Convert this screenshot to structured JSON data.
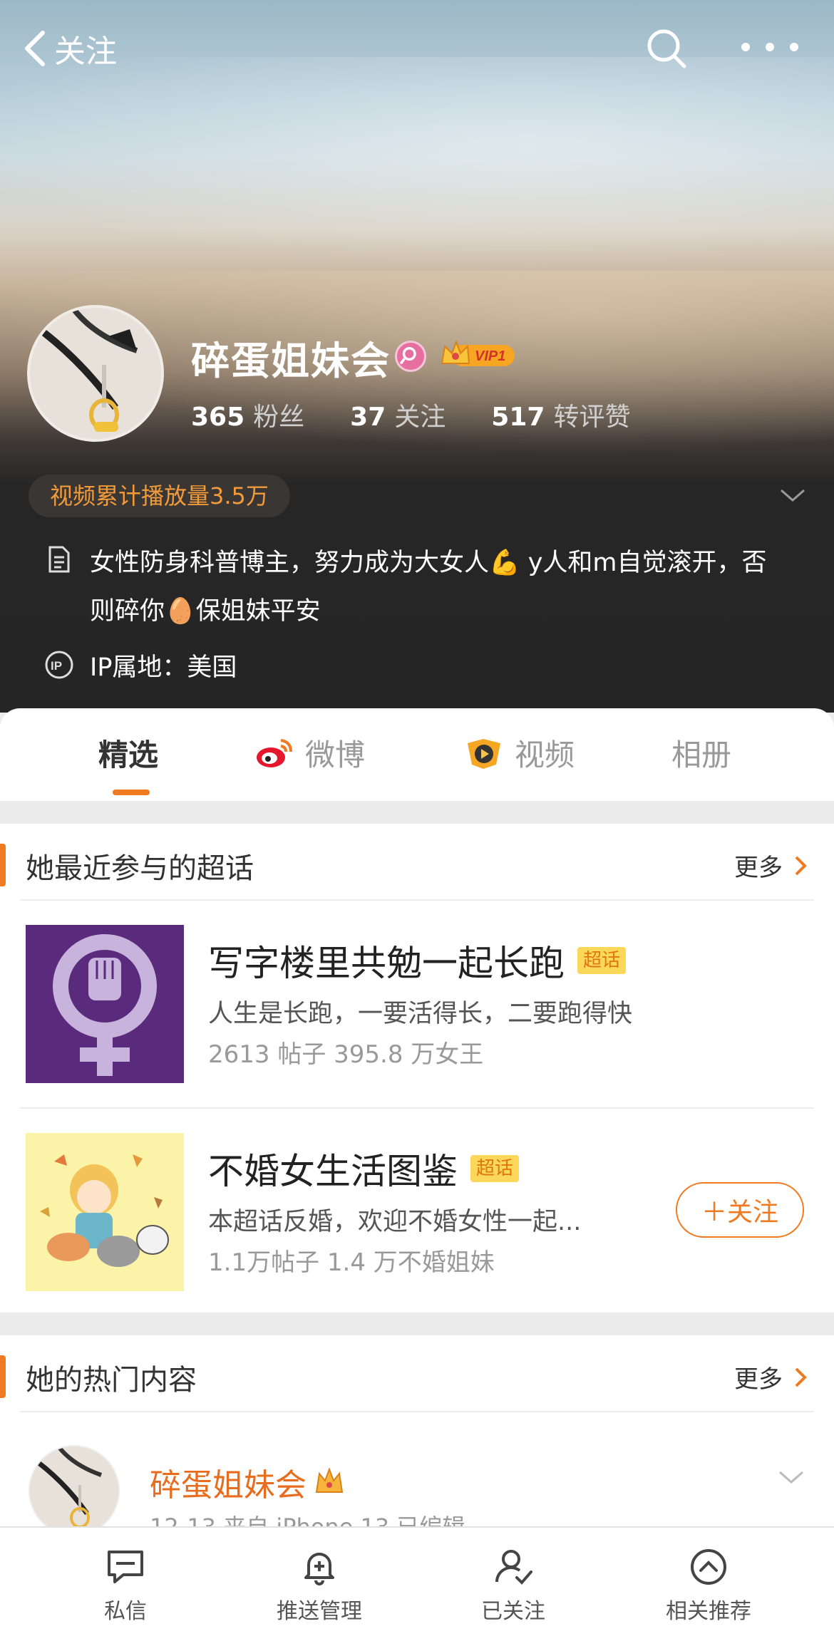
{
  "header": {
    "back_label": "关注",
    "profile_name": "碎蛋姐妹会",
    "vip_label": "VIP1",
    "stats": [
      {
        "value": "365",
        "label": "粉丝"
      },
      {
        "value": "37",
        "label": "关注"
      },
      {
        "value": "517",
        "label": "转评赞"
      }
    ],
    "video_play_count": "视频累计播放量3.5万",
    "bio": "女性防身科普博主，努力成为大女人💪 y人和m自觉滚开，否则碎你🥚保姐妹平安",
    "ip_location": "IP属地：美国"
  },
  "tabs": [
    {
      "label": "精选",
      "active": true
    },
    {
      "label": "微博",
      "icon": "weibo-icon"
    },
    {
      "label": "视频",
      "icon": "video-icon"
    },
    {
      "label": "相册"
    }
  ],
  "super_topics": {
    "title": "她最近参与的超话",
    "more_label": "更多",
    "items": [
      {
        "title": "写字楼里共勉一起长跑",
        "tag": "超话",
        "desc": "人生是长跑，一要活得长，二要跑得快",
        "meta": "2613 帖子 395.8 万女王"
      },
      {
        "title": "不婚女生活图鉴",
        "tag": "超话",
        "desc": "本超话反婚，欢迎不婚女性一起...",
        "meta": "1.1万帖子 1.4 万不婚姐妹",
        "follow_label": "＋关注"
      }
    ]
  },
  "hot_content": {
    "title": "她的热门内容",
    "more_label": "更多",
    "post": {
      "author": "碎蛋姐妹会",
      "meta": "12-13  来自 iPhone 13  已编辑"
    }
  },
  "bottom_bar": [
    {
      "label": "私信",
      "icon": "message-icon"
    },
    {
      "label": "推送管理",
      "icon": "bell-plus-icon"
    },
    {
      "label": "已关注",
      "icon": "user-check-icon"
    },
    {
      "label": "相关推荐",
      "icon": "chevron-circle-icon"
    }
  ],
  "colors": {
    "accent": "#f07a21",
    "play_count": "#f39a3a",
    "tag_bg": "#fbd75a",
    "gender_badge": "#e76fa0"
  }
}
